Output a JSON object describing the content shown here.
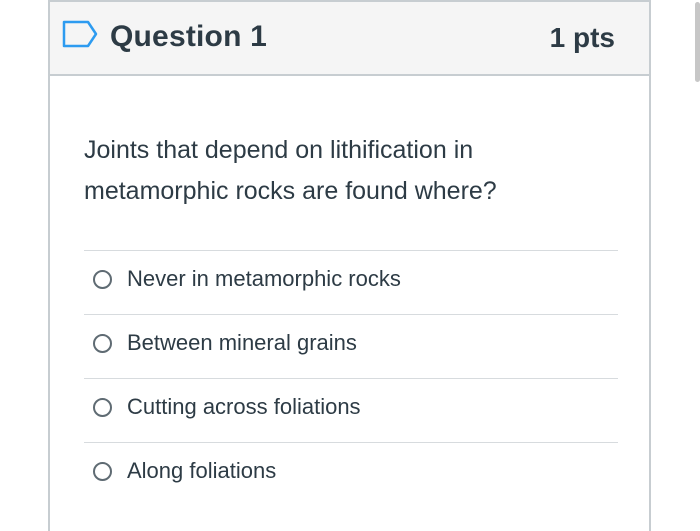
{
  "question": {
    "title": "Question 1",
    "points": "1 pts",
    "text": "Joints that depend on lithification in metamorphic rocks are found where?",
    "answers": [
      {
        "label": "Never in metamorphic rocks"
      },
      {
        "label": "Between mineral grains"
      },
      {
        "label": "Cutting across foliations"
      },
      {
        "label": "Along foliations"
      }
    ]
  },
  "colors": {
    "text": "#2d3b45",
    "header_bg": "#f5f5f5",
    "border": "#c7cdd1",
    "flag": "#2d9bf0"
  },
  "icons": {
    "flag": "flag-question-icon",
    "radio": "radio-button-icon"
  }
}
